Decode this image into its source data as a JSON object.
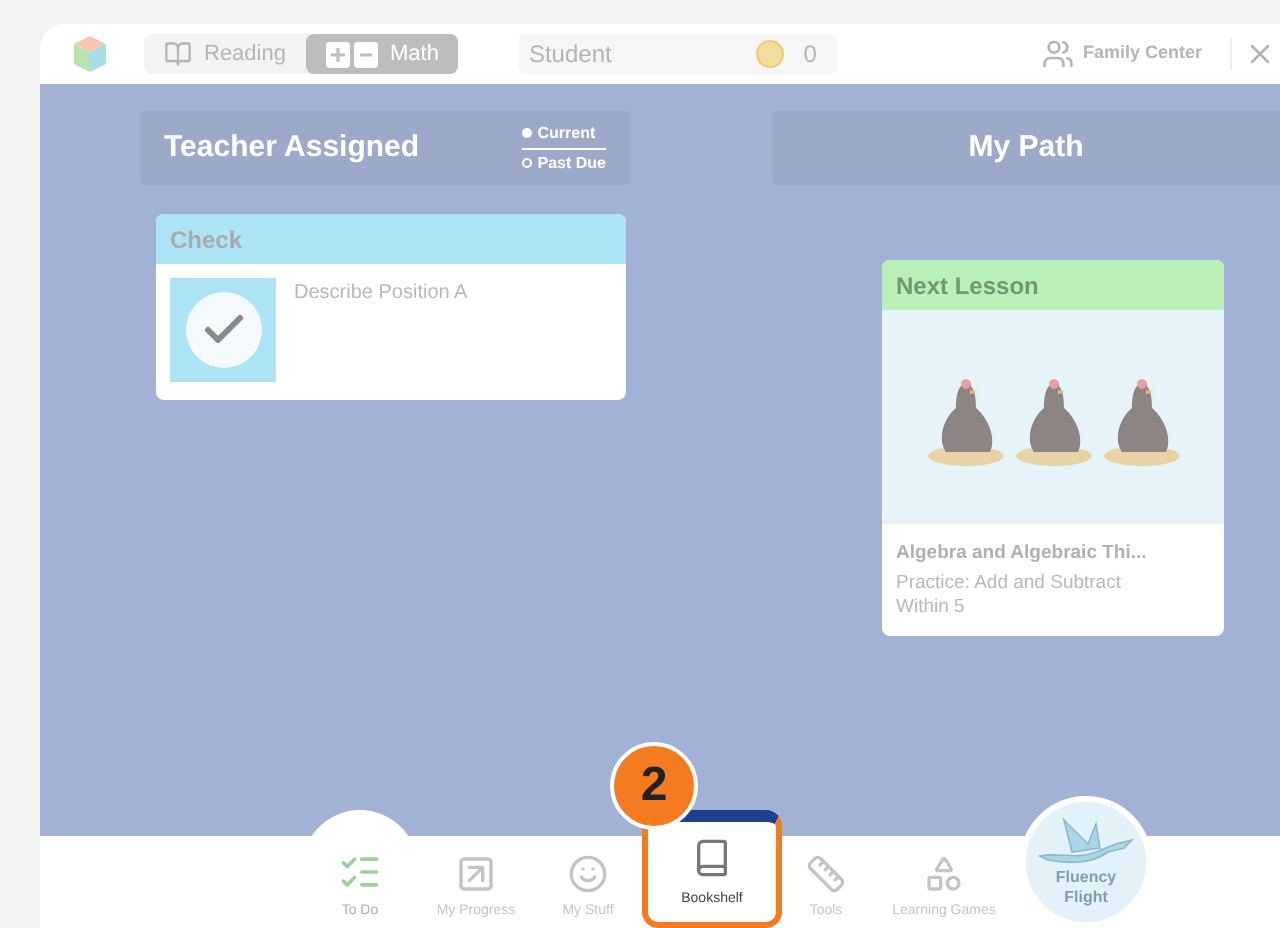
{
  "top_bar": {
    "subject_tabs": [
      {
        "label": "Reading",
        "selected": false
      },
      {
        "label": "Math",
        "selected": true
      }
    ],
    "student": "Student",
    "coins": "0",
    "family_center": "Family Center"
  },
  "teacher_assigned": {
    "title": "Teacher Assigned",
    "filters": [
      {
        "label": "Current",
        "selected": true
      },
      {
        "label": "Past Due",
        "selected": false
      }
    ],
    "cards": [
      {
        "header": "Check",
        "title": "Describe Position A"
      }
    ]
  },
  "my_path": {
    "title": "My Path",
    "card": {
      "header": "Next Lesson",
      "domain": "Algebra and Algebraic Thi...",
      "description": "Practice: Add and Subtract Within 5"
    }
  },
  "nav": [
    {
      "kind": "todo",
      "label": "To Do",
      "selected": true,
      "highlighted": false
    },
    {
      "kind": "progress",
      "label": "My Progress",
      "selected": false,
      "highlighted": false
    },
    {
      "kind": "stuff",
      "label": "My Stuff",
      "selected": false,
      "highlighted": false
    },
    {
      "kind": "bookshelf",
      "label": "Bookshelf",
      "selected": false,
      "highlighted": true,
      "step": "2"
    },
    {
      "kind": "tools",
      "label": "Tools",
      "selected": false,
      "highlighted": false
    },
    {
      "kind": "games",
      "label": "Learning Games",
      "selected": false,
      "highlighted": false
    },
    {
      "kind": "fluency",
      "label": "Fluency Flight",
      "selected": false,
      "highlighted": false
    }
  ]
}
